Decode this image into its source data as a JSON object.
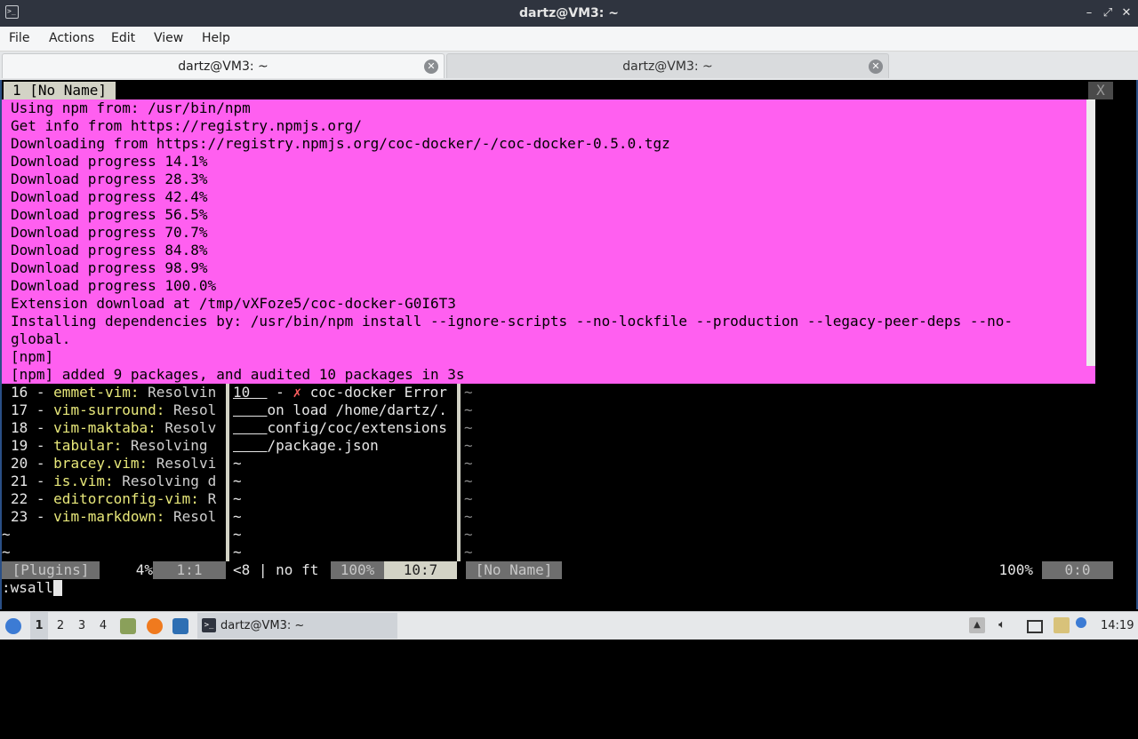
{
  "window": {
    "title": "dartz@VM3: ~",
    "controls": {
      "minimize": "–",
      "maximize": "⤢",
      "close": "✕"
    }
  },
  "menu": [
    "File",
    "Actions",
    "Edit",
    "View",
    "Help"
  ],
  "tabs": [
    {
      "label": "dartz@VM3: ~",
      "active": true
    },
    {
      "label": "dartz@VM3: ~",
      "active": false
    }
  ],
  "vim": {
    "tabline": {
      "buffer": "1 [No Name]",
      "close": "X"
    },
    "popup_lines": [
      "Using npm from: /usr/bin/npm",
      "Get info from https://registry.npmjs.org/",
      "Downloading from https://registry.npmjs.org/coc-docker/-/coc-docker-0.5.0.tgz",
      "Download progress 14.1%",
      "Download progress 28.3%",
      "Download progress 42.4%",
      "Download progress 56.5%",
      "Download progress 70.7%",
      "Download progress 84.8%",
      "Download progress 98.9%",
      "Download progress 100.0%",
      "Extension download at /tmp/vXFoze5/coc-docker-G0I6T3",
      "Installing dependencies by: /usr/bin/npm install --ignore-scripts --no-lockfile --production --legacy-peer-deps --no-",
      "global.",
      "[npm]",
      "[npm] added 9 packages, and audited 10 packages in 3s"
    ],
    "plugins": [
      {
        "num": "16 - ",
        "name": "emmet-vim:",
        "status": " Resolvin"
      },
      {
        "num": "17 - ",
        "name": "vim-surround:",
        "status": " Resol"
      },
      {
        "num": "18 - ",
        "name": "vim-maktaba:",
        "status": " Resolv"
      },
      {
        "num": "19 - ",
        "name": "tabular:",
        "status": " Resolving "
      },
      {
        "num": "20 - ",
        "name": "bracey.vim:",
        "status": " Resolvi"
      },
      {
        "num": "21 - ",
        "name": "is.vim:",
        "status": " Resolving d"
      },
      {
        "num": "22 - ",
        "name": "editorconfig-vim:",
        "status": " R"
      },
      {
        "num": "23 - ",
        "name": "vim-markdown:",
        "status": " Resol"
      }
    ],
    "left_tilde": "~",
    "middle": {
      "line1": {
        "lnum": "10  ",
        "gutter": " - ",
        "err_mark": "✗",
        "text": " coc-docker Error "
      },
      "wrap_lines": [
        "on load /home/dartz/.",
        "config/coc/extensions",
        "/package.json"
      ],
      "tilde": "~"
    },
    "right_tilde": "~",
    "statusline": {
      "left_name": "[Plugins]",
      "left_pct": "4%",
      "left_pos": "1:1",
      "mid_info": "<8 | no ft",
      "mid_pct": "100%",
      "mid_pos": "10:7",
      "right_name": "[No Name]",
      "right_pct": "100%",
      "right_pos": "0:0"
    },
    "cmdline": ":wsall"
  },
  "taskbar": {
    "workspaces": [
      "1",
      "2",
      "3",
      "4"
    ],
    "active_workspace": "1",
    "task_label": "dartz@VM3: ~",
    "clock": "14:19",
    "icons": [
      "start-menu-icon",
      "file-manager-icon",
      "firefox-icon",
      "desktop-icon",
      "terminal-icon",
      "tray-arrow-icon",
      "volume-icon",
      "display-icon",
      "clipboard-icon",
      "network-icon"
    ]
  }
}
